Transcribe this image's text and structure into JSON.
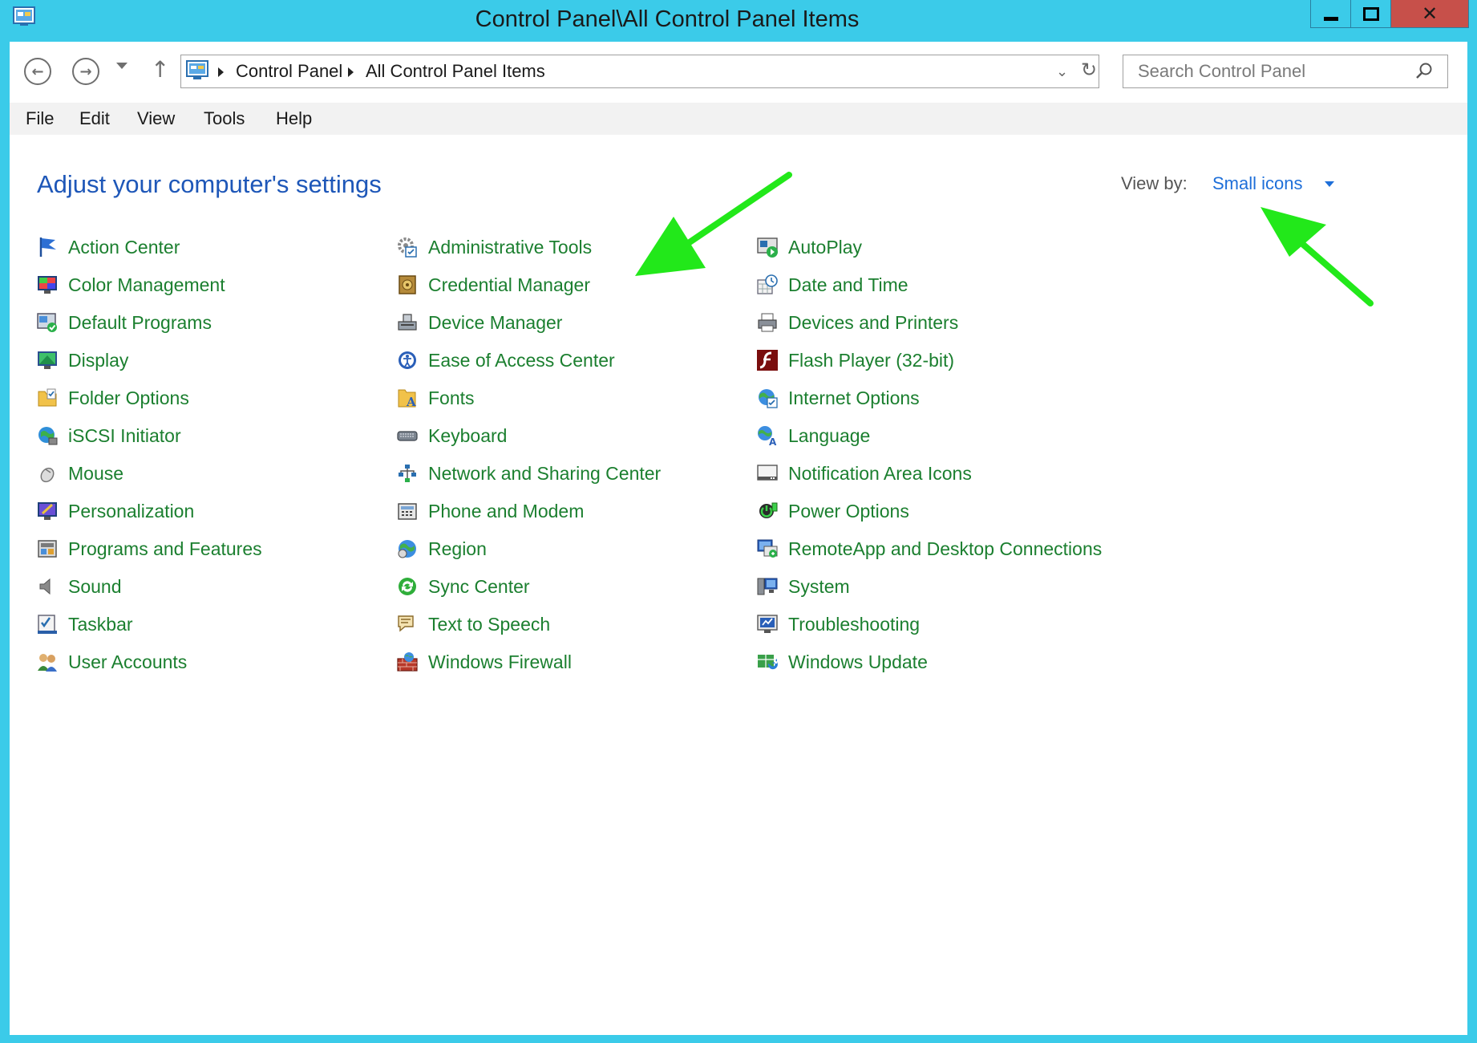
{
  "window": {
    "title": "Control Panel\\All Control Panel Items"
  },
  "nav": {
    "breadcrumbs": [
      "Control Panel",
      "All Control Panel Items"
    ],
    "search_placeholder": "Search Control Panel"
  },
  "menu": [
    "File",
    "Edit",
    "View",
    "Tools",
    "Help"
  ],
  "content": {
    "heading": "Adjust your computer's settings",
    "view_by_label": "View by:",
    "view_by_value": "Small icons"
  },
  "columns": [
    [
      {
        "label": "Action Center",
        "icon": "flag-icon"
      },
      {
        "label": "Color Management",
        "icon": "color-monitor-icon"
      },
      {
        "label": "Default Programs",
        "icon": "default-programs-icon"
      },
      {
        "label": "Display",
        "icon": "display-icon"
      },
      {
        "label": "Folder Options",
        "icon": "folder-options-icon"
      },
      {
        "label": "iSCSI Initiator",
        "icon": "globe-network-icon"
      },
      {
        "label": "Mouse",
        "icon": "mouse-icon"
      },
      {
        "label": "Personalization",
        "icon": "personalization-icon"
      },
      {
        "label": "Programs and Features",
        "icon": "programs-icon"
      },
      {
        "label": "Sound",
        "icon": "speaker-icon"
      },
      {
        "label": "Taskbar",
        "icon": "taskbar-icon"
      },
      {
        "label": "User Accounts",
        "icon": "users-icon"
      }
    ],
    [
      {
        "label": "Administrative Tools",
        "icon": "admin-tools-icon"
      },
      {
        "label": "Credential Manager",
        "icon": "vault-icon"
      },
      {
        "label": "Device Manager",
        "icon": "device-manager-icon"
      },
      {
        "label": "Ease of Access Center",
        "icon": "ease-of-access-icon"
      },
      {
        "label": "Fonts",
        "icon": "fonts-folder-icon"
      },
      {
        "label": "Keyboard",
        "icon": "keyboard-icon"
      },
      {
        "label": "Network and Sharing Center",
        "icon": "network-icon"
      },
      {
        "label": "Phone and Modem",
        "icon": "phone-icon"
      },
      {
        "label": "Region",
        "icon": "region-globe-icon"
      },
      {
        "label": "Sync Center",
        "icon": "sync-icon"
      },
      {
        "label": "Text to Speech",
        "icon": "speech-bubble-icon"
      },
      {
        "label": "Windows Firewall",
        "icon": "firewall-icon"
      }
    ],
    [
      {
        "label": "AutoPlay",
        "icon": "autoplay-icon"
      },
      {
        "label": "Date and Time",
        "icon": "clock-calendar-icon"
      },
      {
        "label": "Devices and Printers",
        "icon": "printer-icon"
      },
      {
        "label": "Flash Player (32-bit)",
        "icon": "flash-icon"
      },
      {
        "label": "Internet Options",
        "icon": "internet-options-icon"
      },
      {
        "label": "Language",
        "icon": "language-icon"
      },
      {
        "label": "Notification Area Icons",
        "icon": "notification-icon"
      },
      {
        "label": "Power Options",
        "icon": "power-icon"
      },
      {
        "label": "RemoteApp and Desktop Connections",
        "icon": "remote-desktop-icon"
      },
      {
        "label": "System",
        "icon": "system-icon"
      },
      {
        "label": "Troubleshooting",
        "icon": "troubleshooting-icon"
      },
      {
        "label": "Windows Update",
        "icon": "windows-update-icon"
      }
    ]
  ],
  "colors": {
    "frame": "#3bcbe9",
    "link_green": "#1b7f2f",
    "heading_blue": "#1e57b8",
    "view_by_blue": "#1e6fd9",
    "annotation_arrow": "#22e81a",
    "close_button": "#c7504a"
  }
}
